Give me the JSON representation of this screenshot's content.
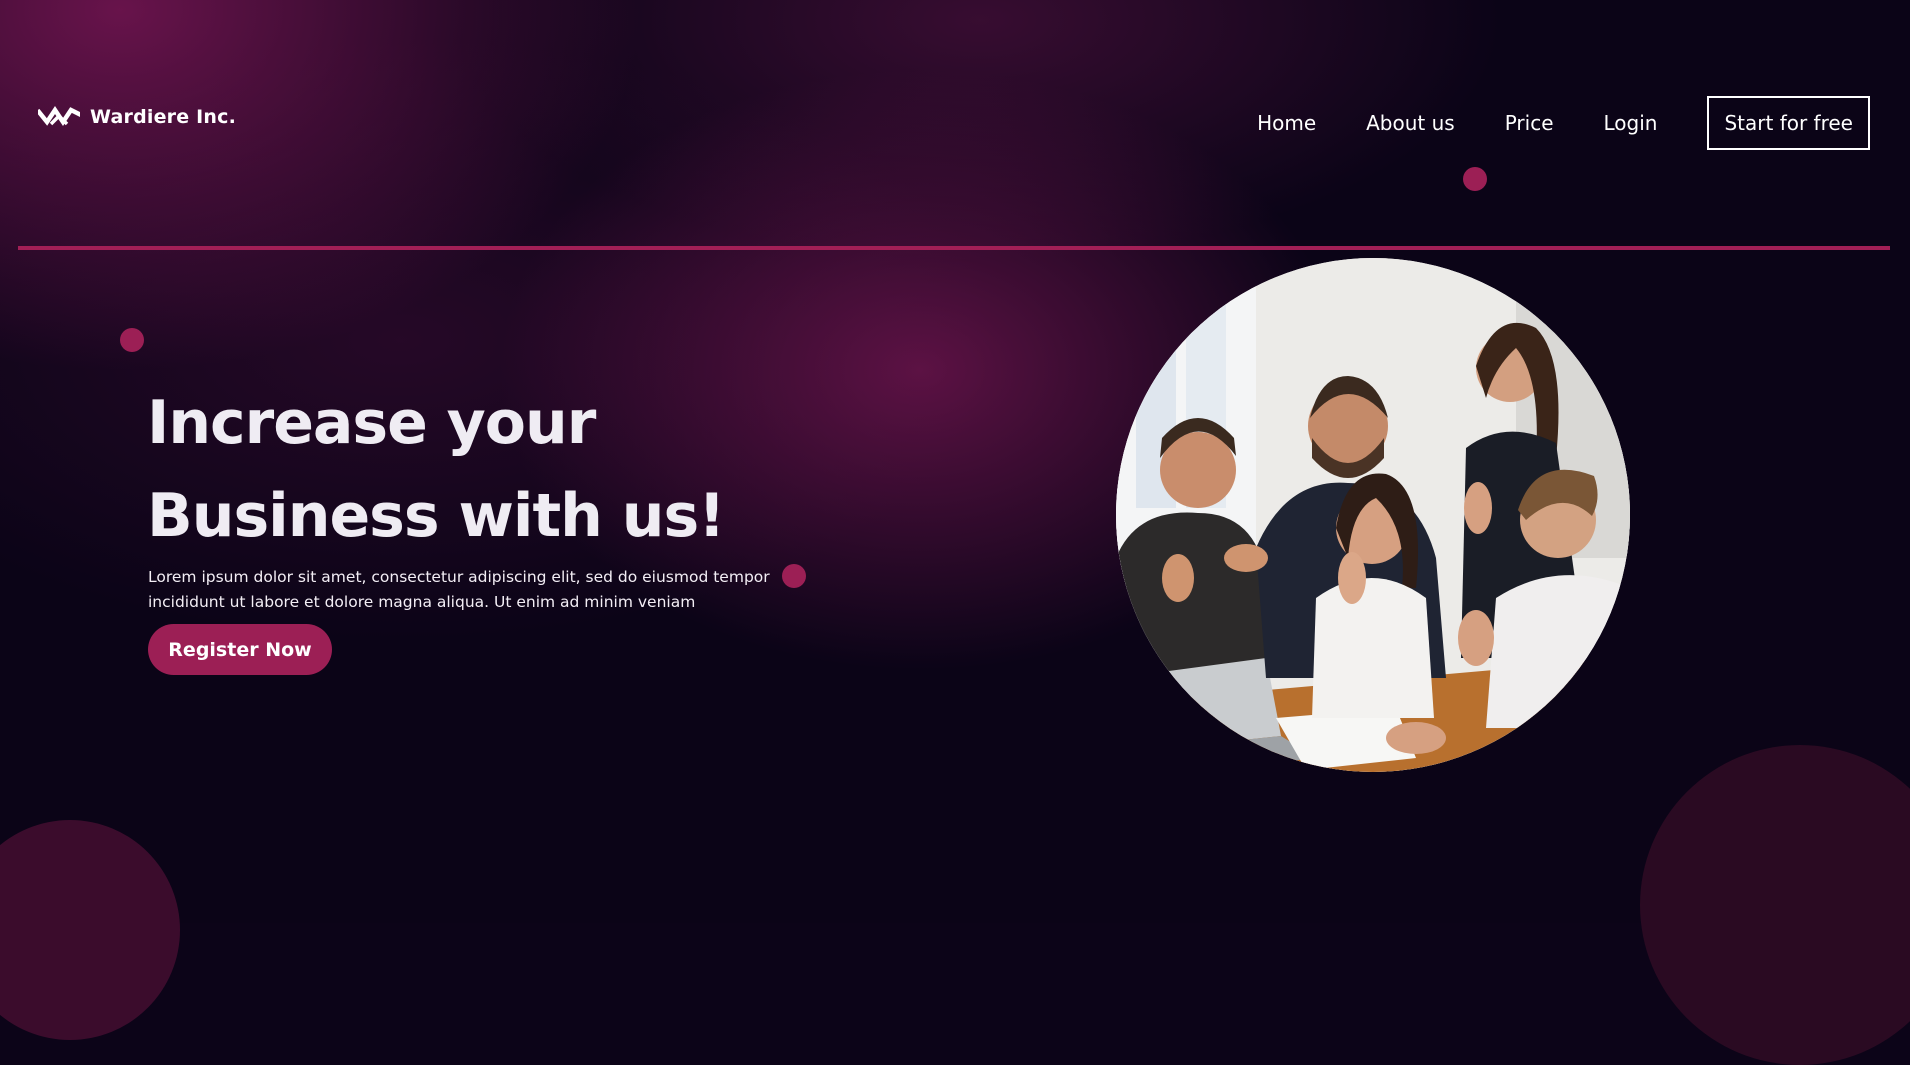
{
  "brand": {
    "name": "Wardiere Inc.",
    "logo_icon": "wardiere-w-logo-icon"
  },
  "nav": {
    "items": [
      {
        "label": "Home"
      },
      {
        "label": "About us"
      },
      {
        "label": "Price"
      },
      {
        "label": "Login"
      }
    ],
    "cta_label": "Start for free"
  },
  "hero": {
    "title_line1": "Increase your",
    "title_line2": "Business with us!",
    "description": "Lorem ipsum dolor sit amet, consectetur adipiscing elit, sed do eiusmod tempor incididunt ut labore et dolore magna aliqua. Ut enim ad minim veniam",
    "register_label": "Register Now",
    "image": "team-celebrating-photo"
  },
  "colors": {
    "accent": "#9c1f55",
    "background": "#0b0417",
    "text": "#efecf3"
  }
}
